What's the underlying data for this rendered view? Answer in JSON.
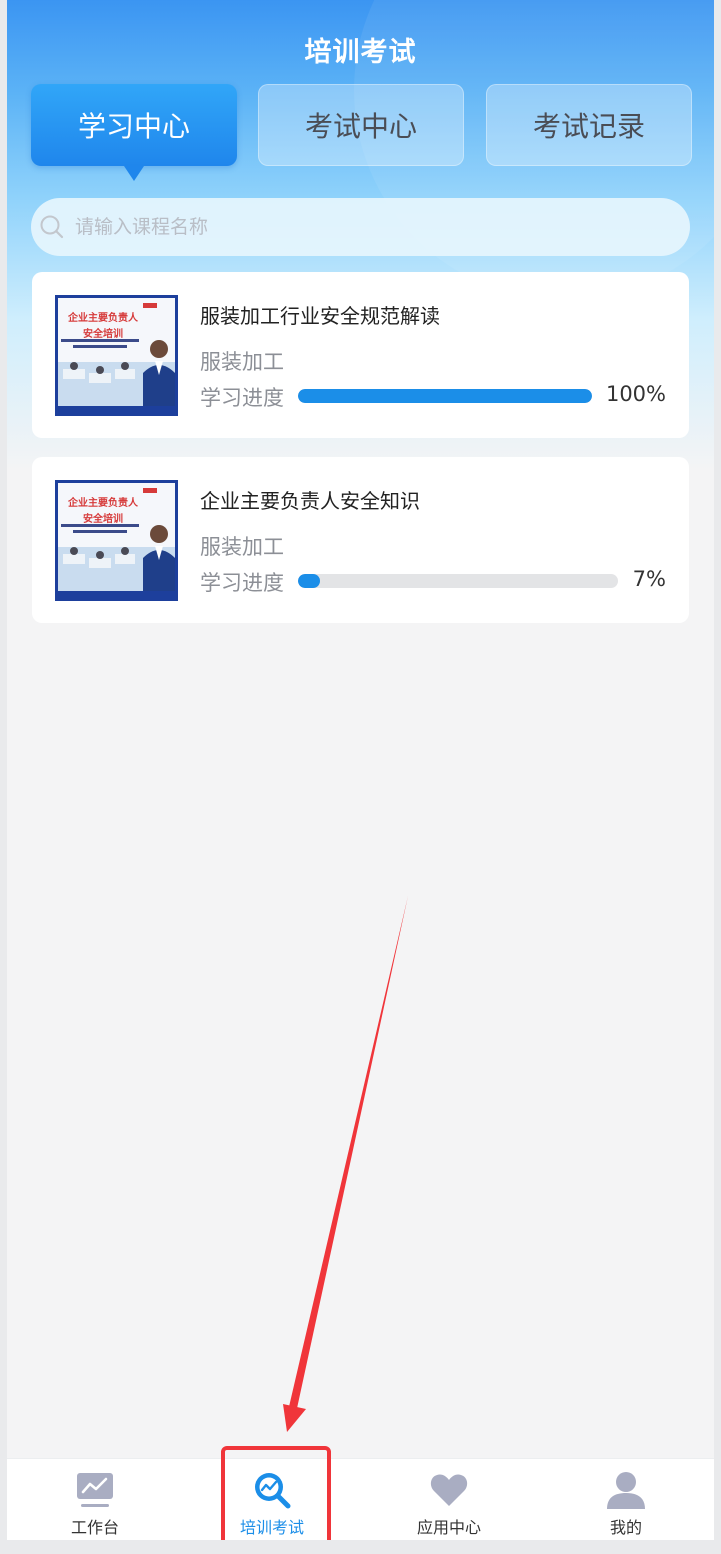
{
  "header": {
    "title": "培训考试"
  },
  "tabs": [
    {
      "label": "学习中心",
      "active": true
    },
    {
      "label": "考试中心",
      "active": false
    },
    {
      "label": "考试记录",
      "active": false
    }
  ],
  "search": {
    "placeholder": "请输入课程名称",
    "value": ""
  },
  "courses": [
    {
      "title": "服装加工行业安全规范解读",
      "category": "服装加工",
      "progress_label": "学习进度",
      "progress_text": "100%",
      "progress_fraction": 1.0,
      "thumbnail": {
        "line1": "企业主要负责人",
        "line2": "安全培训"
      }
    },
    {
      "title": "企业主要负责人安全知识",
      "category": "服装加工",
      "progress_label": "学习进度",
      "progress_text": "7%",
      "progress_fraction": 0.07,
      "thumbnail": {
        "line1": "企业主要负责人",
        "line2": "安全培训"
      }
    }
  ],
  "tabbar": [
    {
      "label": "工作台",
      "icon": "workbench-chart-icon",
      "active": false
    },
    {
      "label": "培训考试",
      "icon": "training-search-icon",
      "active": true
    },
    {
      "label": "应用中心",
      "icon": "heart-icon",
      "active": false
    },
    {
      "label": "我的",
      "icon": "user-icon",
      "active": false
    }
  ],
  "colors": {
    "accent": "#1b8ee8",
    "annotation": "#f0353a",
    "progress_track": "#e3e4e6"
  }
}
